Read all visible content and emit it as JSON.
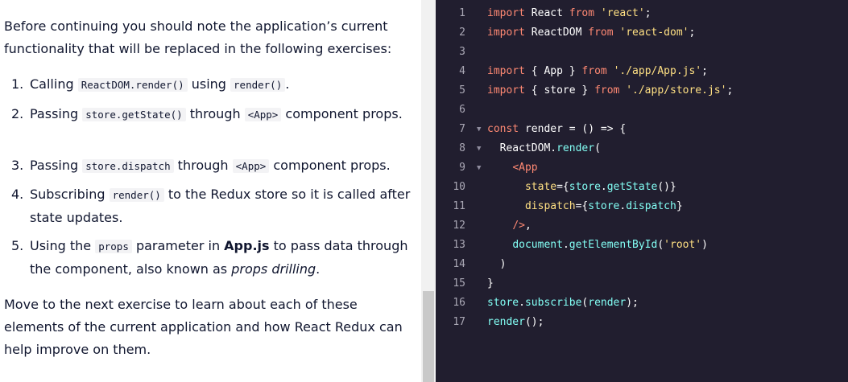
{
  "lesson": {
    "intro": "Before continuing you should note the application’s current functionality that will be replaced in the following exercises:",
    "items": [
      {
        "num": "1.",
        "parts": [
          {
            "t": "text",
            "v": "Calling "
          },
          {
            "t": "code",
            "v": "ReactDOM.render()"
          },
          {
            "t": "text",
            "v": " using "
          },
          {
            "t": "code",
            "v": "render()"
          },
          {
            "t": "text",
            "v": "."
          }
        ]
      },
      {
        "num": "2.",
        "parts": [
          {
            "t": "text",
            "v": "Passing "
          },
          {
            "t": "code",
            "v": "store.getState()"
          },
          {
            "t": "text",
            "v": " through "
          },
          {
            "t": "code",
            "v": "<App>"
          },
          {
            "t": "text",
            "v": " component props."
          }
        ]
      },
      {
        "num": "3.",
        "parts": [
          {
            "t": "text",
            "v": "Passing "
          },
          {
            "t": "code",
            "v": "store.dispatch"
          },
          {
            "t": "text",
            "v": " through "
          },
          {
            "t": "code",
            "v": "<App>"
          },
          {
            "t": "text",
            "v": " component props."
          }
        ]
      },
      {
        "num": "4.",
        "parts": [
          {
            "t": "text",
            "v": "Subscribing "
          },
          {
            "t": "code",
            "v": "render()"
          },
          {
            "t": "text",
            "v": " to the Redux store so it is called after state updates."
          }
        ]
      },
      {
        "num": "5.",
        "parts": [
          {
            "t": "text",
            "v": "Using the "
          },
          {
            "t": "code",
            "v": "props"
          },
          {
            "t": "text",
            "v": " parameter in "
          },
          {
            "t": "bold",
            "v": "App.js"
          },
          {
            "t": "text",
            "v": " to pass data through the component, also known as "
          },
          {
            "t": "em",
            "v": "props drilling"
          },
          {
            "t": "text",
            "v": "."
          }
        ]
      }
    ],
    "outro": "Move to the next exercise to learn about each of these elements of the current application and how React Redux can help improve on them."
  },
  "editor": {
    "lines": [
      {
        "n": "1",
        "fold": false,
        "tokens": [
          [
            "kw",
            "import"
          ],
          [
            "plain",
            " React "
          ],
          [
            "kw",
            "from"
          ],
          [
            "plain",
            " "
          ],
          [
            "str",
            "'react'"
          ],
          [
            "plain",
            ";"
          ]
        ]
      },
      {
        "n": "2",
        "fold": false,
        "tokens": [
          [
            "kw",
            "import"
          ],
          [
            "plain",
            " ReactDOM "
          ],
          [
            "kw",
            "from"
          ],
          [
            "plain",
            " "
          ],
          [
            "str",
            "'react-dom'"
          ],
          [
            "plain",
            ";"
          ]
        ]
      },
      {
        "n": "3",
        "fold": false,
        "tokens": []
      },
      {
        "n": "4",
        "fold": false,
        "tokens": [
          [
            "kw",
            "import"
          ],
          [
            "plain",
            " { App } "
          ],
          [
            "kw",
            "from"
          ],
          [
            "plain",
            " "
          ],
          [
            "str",
            "'./app/App.js'"
          ],
          [
            "plain",
            ";"
          ]
        ]
      },
      {
        "n": "5",
        "fold": false,
        "tokens": [
          [
            "kw",
            "import"
          ],
          [
            "plain",
            " { store } "
          ],
          [
            "kw",
            "from"
          ],
          [
            "plain",
            " "
          ],
          [
            "str",
            "'./app/store.js'"
          ],
          [
            "plain",
            ";"
          ]
        ]
      },
      {
        "n": "6",
        "fold": false,
        "tokens": []
      },
      {
        "n": "7",
        "fold": true,
        "tokens": [
          [
            "kw",
            "const"
          ],
          [
            "plain",
            " render = () => {"
          ]
        ]
      },
      {
        "n": "8",
        "fold": true,
        "tokens": [
          [
            "plain",
            "  ReactDOM"
          ],
          [
            "plain",
            "."
          ],
          [
            "var",
            "render"
          ],
          [
            "plain",
            "("
          ]
        ]
      },
      {
        "n": "9",
        "fold": true,
        "tokens": [
          [
            "plain",
            "    "
          ],
          [
            "tag",
            "<App"
          ]
        ]
      },
      {
        "n": "10",
        "fold": false,
        "tokens": [
          [
            "plain",
            "      "
          ],
          [
            "attr",
            "state"
          ],
          [
            "plain",
            "={"
          ],
          [
            "var",
            "store"
          ],
          [
            "plain",
            "."
          ],
          [
            "var",
            "getState"
          ],
          [
            "plain",
            "()}"
          ]
        ]
      },
      {
        "n": "11",
        "fold": false,
        "tokens": [
          [
            "plain",
            "      "
          ],
          [
            "attr",
            "dispatch"
          ],
          [
            "plain",
            "={"
          ],
          [
            "var",
            "store"
          ],
          [
            "plain",
            "."
          ],
          [
            "var",
            "dispatch"
          ],
          [
            "plain",
            "}"
          ]
        ]
      },
      {
        "n": "12",
        "fold": false,
        "tokens": [
          [
            "plain",
            "    "
          ],
          [
            "tag",
            "/>"
          ],
          [
            "plain",
            ","
          ]
        ]
      },
      {
        "n": "13",
        "fold": false,
        "tokens": [
          [
            "plain",
            "    "
          ],
          [
            "var",
            "document"
          ],
          [
            "plain",
            "."
          ],
          [
            "var",
            "getElementById"
          ],
          [
            "plain",
            "("
          ],
          [
            "str",
            "'root'"
          ],
          [
            "plain",
            ")"
          ]
        ]
      },
      {
        "n": "14",
        "fold": false,
        "tokens": [
          [
            "plain",
            "  )"
          ]
        ]
      },
      {
        "n": "15",
        "fold": false,
        "tokens": [
          [
            "plain",
            "}"
          ]
        ]
      },
      {
        "n": "16",
        "fold": false,
        "tokens": [
          [
            "var",
            "store"
          ],
          [
            "plain",
            "."
          ],
          [
            "var",
            "subscribe"
          ],
          [
            "plain",
            "("
          ],
          [
            "var",
            "render"
          ],
          [
            "plain",
            ");"
          ]
        ]
      },
      {
        "n": "17",
        "fold": false,
        "tokens": [
          [
            "var",
            "render"
          ],
          [
            "plain",
            "();"
          ]
        ]
      }
    ],
    "fold_icon": "chevron-down-icon"
  },
  "colors": {
    "editor_bg": "#211e2f",
    "keyword": "#ff8973",
    "string": "#ffe083",
    "identifier": "#83fff5",
    "text": "#10162f"
  }
}
